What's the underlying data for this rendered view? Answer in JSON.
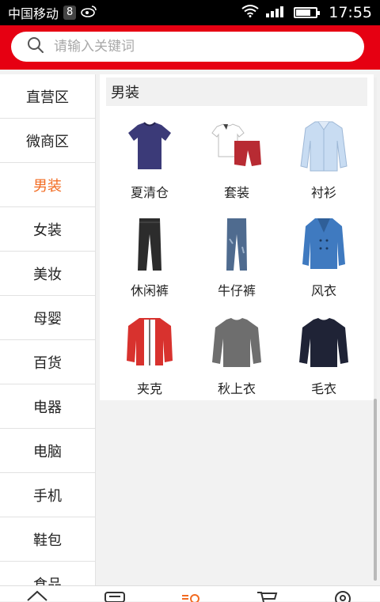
{
  "status_bar": {
    "carrier": "中国移动",
    "badge": "8",
    "time": "17:55",
    "battery_level": 0.7
  },
  "search": {
    "placeholder": "请输入关键词"
  },
  "sidebar": {
    "items": [
      "直营区",
      "微商区",
      "男装",
      "女装",
      "美妆",
      "母婴",
      "百货",
      "电器",
      "电脑",
      "手机",
      "鞋包",
      "食品"
    ],
    "active_index": 2
  },
  "category": {
    "title": "男装",
    "products": [
      {
        "label": "夏清仓",
        "icon": "tshirt"
      },
      {
        "label": "套装",
        "icon": "shirt-shorts-set"
      },
      {
        "label": "衬衫",
        "icon": "dress-shirt"
      },
      {
        "label": "休闲裤",
        "icon": "casual-pants"
      },
      {
        "label": "牛仔裤",
        "icon": "jeans"
      },
      {
        "label": "风衣",
        "icon": "trench-coat"
      },
      {
        "label": "夹克",
        "icon": "jacket"
      },
      {
        "label": "秋上衣",
        "icon": "sweatshirt"
      },
      {
        "label": "毛衣",
        "icon": "sweater"
      }
    ]
  },
  "colors": {
    "brand_red": "#e60012",
    "active_orange": "#f26b21"
  },
  "tabbar": {
    "icons": [
      "home-icon",
      "category-list-icon",
      "category-icon",
      "cart-icon",
      "user-icon"
    ],
    "active_index": 2
  }
}
